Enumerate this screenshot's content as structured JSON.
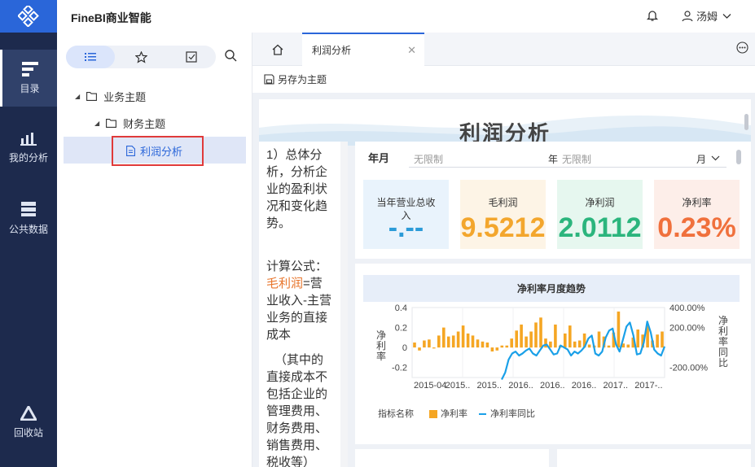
{
  "app": {
    "title": "FineBI商业智能",
    "user": "汤姆"
  },
  "nav": {
    "catalog": "目录",
    "my_analysis": "我的分析",
    "public_data": "公共数据",
    "recycle": "回收站"
  },
  "tree": {
    "root": "业务主题",
    "child": "财务主题",
    "leaf": "利润分析"
  },
  "tabs": {
    "active": "利润分析"
  },
  "toolbar": {
    "save_as": "另存为主题"
  },
  "dashboard": {
    "title": "利润分析",
    "description": {
      "intro": "1）总体分析，分析企业的盈利状况和变化趋势。",
      "formula_label": "计算公式：",
      "gross_profit_term": "毛利润",
      "gross_profit_def": "=营业收入-主营业务的直接成本",
      "note": "（其中的直接成本不包括企业的管理费用、财务费用、销售费用、税收等）"
    },
    "filter": {
      "label": "年月",
      "placeholder": "无限制",
      "year_unit": "年",
      "year_placeholder": "无限制",
      "month_unit": "月"
    },
    "kpis": [
      {
        "label": "当年营业总收入",
        "value": "-.--",
        "bg": "#e9f3fc",
        "color": "#2b9bd8"
      },
      {
        "label": "毛利润",
        "value": "9.5212",
        "bg": "#fdf4e6",
        "color": "#f3a62d"
      },
      {
        "label": "净利润",
        "value": "2.0112",
        "bg": "#e6f7ef",
        "color": "#2bb57d"
      },
      {
        "label": "净利率",
        "value": "0.23%",
        "bg": "#fdeee9",
        "color": "#f0703c"
      }
    ],
    "chart_header": "净利率月度趋势",
    "legend_title": "指标名称",
    "colors": {
      "bar": "#f5a623",
      "line": "#1aa0e8"
    }
  },
  "chart_data": {
    "type": "bar",
    "title": "净利率月度趋势",
    "ylabel": "净利率",
    "y2label": "净利率同比",
    "ylim": [
      -0.3,
      0.4
    ],
    "y_ticks": [
      "0.4",
      "0.2",
      "0",
      "-0.2"
    ],
    "y2lim": [
      -300,
      400
    ],
    "y2_ticks": [
      "400.00%",
      "200.00%",
      "-200.00%"
    ],
    "x_tick_labels": [
      "2015-04",
      "2015..",
      "2015..",
      "2016..",
      "2016..",
      "2016..",
      "2017..",
      "2017-.."
    ],
    "series": [
      {
        "name": "净利率",
        "type": "bar",
        "values": [
          0.05,
          -0.03,
          0.07,
          0.08,
          -0.01,
          0.12,
          0.2,
          0.11,
          0.12,
          0.16,
          0.22,
          0.14,
          0.12,
          0.08,
          0.06,
          0.05,
          -0.04,
          -0.03,
          0.02,
          0.02,
          0.09,
          0.17,
          0.23,
          0.11,
          0.16,
          0.25,
          0.3,
          0.09,
          0.06,
          0.23,
          0.02,
          0.14,
          0.22,
          0.06,
          0.07,
          0.14,
          0.03,
          0.02,
          0.16,
          0.11,
          0.02,
          0.15,
          0.36,
          0.04,
          0.03,
          0.1,
          0.18,
          0.13,
          0.22,
          0.07,
          0.13,
          0.16
        ]
      },
      {
        "name": "净利率同比",
        "type": "line",
        "values": [
          -320,
          -250,
          -120,
          -60,
          -40,
          -80,
          -60,
          -30,
          -10,
          -60,
          -80,
          -30,
          20,
          30,
          -20,
          -70,
          -60,
          20,
          0,
          -20,
          -80,
          -40,
          -60,
          -30,
          10,
          90,
          120,
          -60,
          -80,
          -40,
          100,
          170,
          190,
          30,
          -40,
          80,
          210,
          250,
          120,
          -70,
          -60,
          50,
          260,
          150,
          -20,
          -60,
          -80,
          10
        ]
      }
    ]
  }
}
